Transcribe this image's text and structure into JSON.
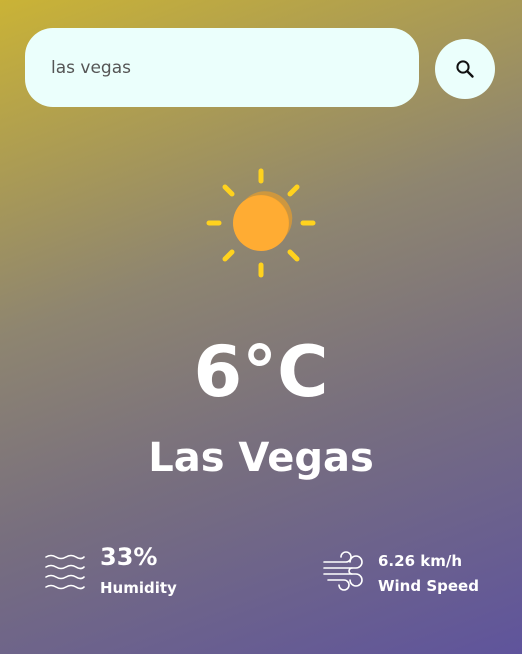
{
  "search": {
    "value": "las vegas",
    "button_icon": "search-icon"
  },
  "weather": {
    "icon": "sun-icon",
    "temperature": "6°C",
    "city": "Las Vegas"
  },
  "details": {
    "humidity": {
      "icon": "waves-icon",
      "value": "33%",
      "label": "Humidity"
    },
    "wind": {
      "icon": "wind-icon",
      "value": "6.26 km/h",
      "label": "Wind Speed"
    }
  },
  "colors": {
    "gradient_start": "#cab336",
    "gradient_end": "#5f549c",
    "field_background": "#ebfffc",
    "sun_core": "#ffac33",
    "sun_rays": "#ffd21e",
    "text": "#ffffff"
  }
}
